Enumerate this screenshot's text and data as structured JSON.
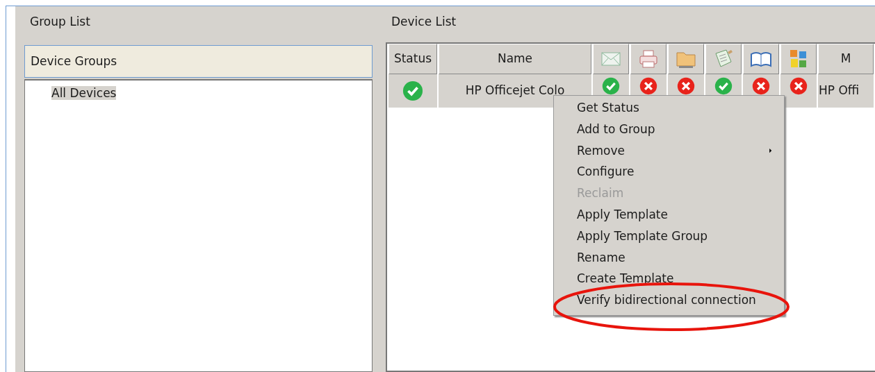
{
  "group_list": {
    "title": "Group List",
    "header": "Device Groups",
    "items": [
      {
        "label": "All Devices",
        "selected": true
      }
    ]
  },
  "device_list": {
    "title": "Device List",
    "columns": [
      {
        "kind": "text",
        "label": "Status"
      },
      {
        "kind": "text",
        "label": "Name"
      },
      {
        "kind": "icon"
      },
      {
        "kind": "icon"
      },
      {
        "kind": "icon"
      },
      {
        "kind": "icon"
      },
      {
        "kind": "icon"
      },
      {
        "kind": "icon"
      },
      {
        "kind": "text",
        "label": "M"
      }
    ],
    "rows": [
      {
        "selected": true,
        "status_ok": true,
        "name": "HP Officejet Colo",
        "capabilities": [
          {
            "ok": true
          },
          {
            "ok": false
          },
          {
            "ok": false
          },
          {
            "ok": true
          },
          {
            "ok": false
          },
          {
            "ok": false
          }
        ],
        "model": "HP Offi"
      }
    ]
  },
  "context_menu": {
    "items": [
      {
        "label": "Get Status",
        "disabled": false,
        "submenu": false,
        "highlighted": false
      },
      {
        "label": "Add to Group",
        "disabled": false,
        "submenu": false,
        "highlighted": false
      },
      {
        "label": "Remove",
        "disabled": false,
        "submenu": true,
        "highlighted": false
      },
      {
        "label": "Configure",
        "disabled": false,
        "submenu": false,
        "highlighted": false
      },
      {
        "label": "Reclaim",
        "disabled": true,
        "submenu": false,
        "highlighted": false
      },
      {
        "label": "Apply Template",
        "disabled": false,
        "submenu": false,
        "highlighted": false
      },
      {
        "label": "Apply Template Group",
        "disabled": false,
        "submenu": false,
        "highlighted": false
      },
      {
        "label": "Rename",
        "disabled": false,
        "submenu": false,
        "highlighted": false
      },
      {
        "label": "Create Template",
        "disabled": false,
        "submenu": false,
        "highlighted": false
      },
      {
        "label": "Verify bidirectional connection",
        "disabled": false,
        "submenu": false,
        "highlighted": true
      }
    ]
  }
}
